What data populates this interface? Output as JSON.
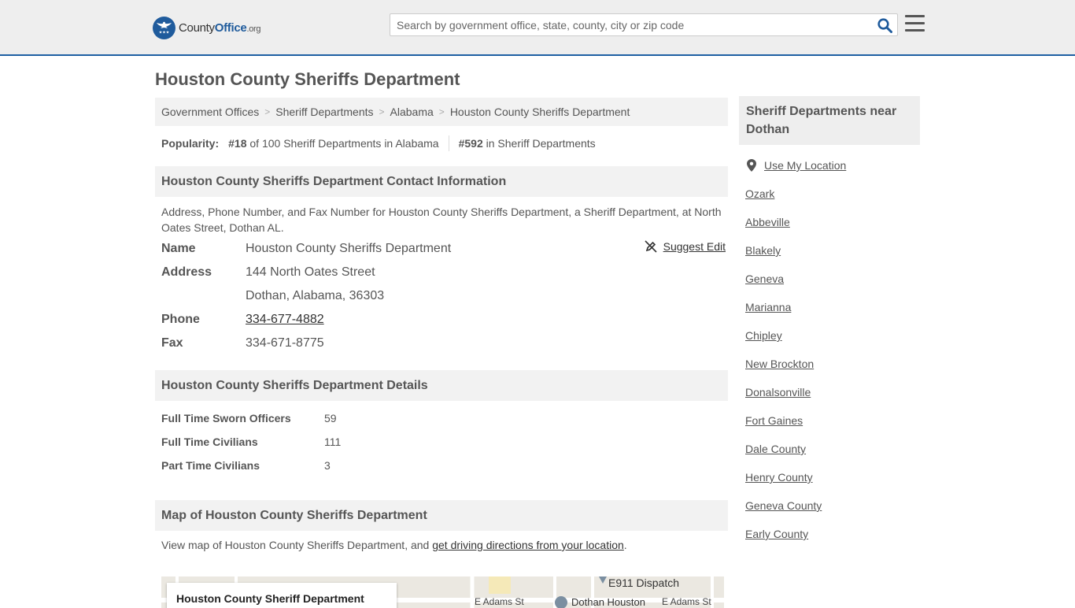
{
  "header": {
    "logo_county": "County",
    "logo_office": "Office",
    "logo_org": ".org",
    "search_placeholder": "Search by government office, state, county, city or zip code",
    "search_icon": "search-icon",
    "menu_icon": "hamburger-icon"
  },
  "page": {
    "title": "Houston County Sheriffs Department"
  },
  "breadcrumb": [
    "Government Offices",
    "Sheriff Departments",
    "Alabama",
    "Houston County Sheriffs Department"
  ],
  "popularity": {
    "label": "Popularity:",
    "state_rank": "#18",
    "state_text": "of 100 Sheriff Departments in Alabama",
    "national_rank": "#592",
    "national_text": "in Sheriff Departments"
  },
  "contact": {
    "heading": "Houston County Sheriffs Department Contact Information",
    "description": "Address, Phone Number, and Fax Number for Houston County Sheriffs Department, a Sheriff Department, at North Oates Street, Dothan AL.",
    "suggest_edit": "Suggest Edit",
    "rows": [
      {
        "label": "Name",
        "value": "Houston County Sheriffs Department"
      },
      {
        "label": "Address",
        "value": "144 North Oates Street"
      },
      {
        "label": "",
        "value": "Dothan, Alabama, 36303"
      },
      {
        "label": "Phone",
        "value": "334-677-4882"
      },
      {
        "label": "Fax",
        "value": "334-671-8775"
      }
    ]
  },
  "details": {
    "heading": "Houston County Sheriffs Department Details",
    "rows": [
      {
        "label": "Full Time Sworn Officers",
        "value": "59"
      },
      {
        "label": "Full Time Civilians",
        "value": "111"
      },
      {
        "label": "Part Time Civilians",
        "value": "3"
      }
    ]
  },
  "map_section": {
    "heading": "Map of Houston County Sheriffs Department",
    "desc_prefix": "View map of Houston County Sheriffs Department, and ",
    "desc_link": "get driving directions from your location",
    "desc_suffix": ".",
    "card_title": "Houston County Sheriff Department",
    "labels": [
      "E911 Dispatch",
      "E Adams St",
      "Dothan Houston",
      "E Adams St"
    ]
  },
  "sidebar": {
    "heading": "Sheriff Departments near Dothan",
    "use_location": "Use My Location",
    "items": [
      "Ozark",
      "Abbeville",
      "Blakely",
      "Geneva",
      "Marianna",
      "Chipley",
      "New Brockton",
      "Donalsonville",
      "Fort Gaines",
      "Dale County",
      "Henry County",
      "Geneva County",
      "Early County"
    ]
  },
  "colors": {
    "brand_blue": "#1f5b9c",
    "header_bg": "#eeeeee",
    "section_bg": "#f2f2f2"
  }
}
